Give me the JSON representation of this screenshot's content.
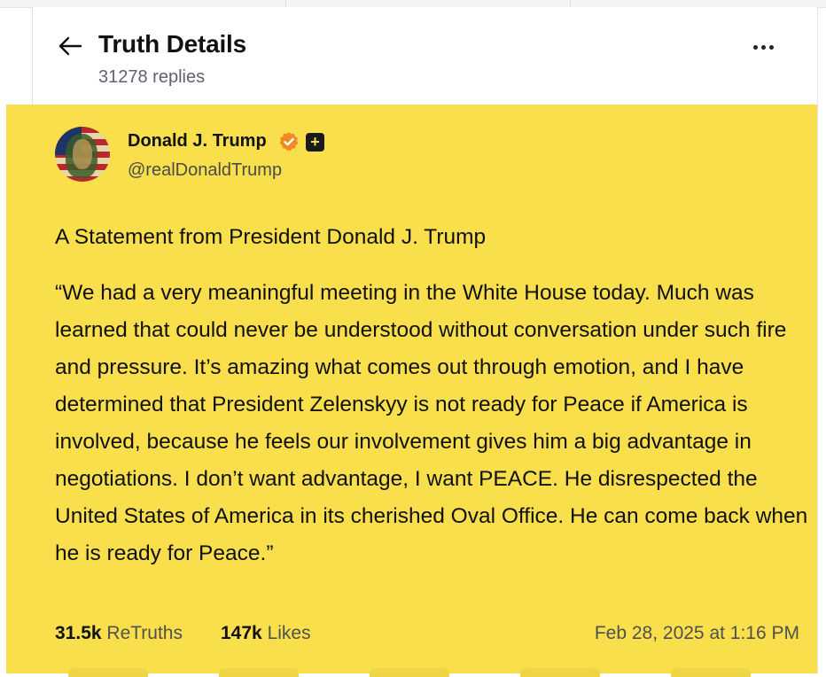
{
  "header": {
    "title": "Truth Details",
    "subtitle": "31278 replies",
    "back_icon": "arrow-left-icon",
    "more_icon": "ellipsis-icon"
  },
  "post": {
    "author": {
      "name": "Donald J. Trump",
      "handle": "@realDonaldTrump",
      "verified_icon": "verified-badge-icon",
      "verified_color": "#f08a24",
      "plus_badge": "+"
    },
    "paragraphs": [
      "A Statement from President Donald J. Trump",
      "“We had a very meaningful meeting in the White House today. Much was learned that could never be understood without conversation under such fire and pressure. It’s amazing what comes out through emotion, and I have determined that President Zelenskyy is not ready for Peace if America is involved, because he feels our involvement gives him a big advantage in negotiations. I don’t want advantage, I want PEACE. He disrespected the United States of America in its cherished Oval Office. He can come back when he is ready for Peace.”"
    ],
    "stats": {
      "retruths_count": "31.5k",
      "retruths_label": "ReTruths",
      "likes_count": "147k",
      "likes_label": "Likes",
      "timestamp": "Feb 28, 2025 at 1:16 PM"
    },
    "highlight_color": "#f9df4c"
  }
}
